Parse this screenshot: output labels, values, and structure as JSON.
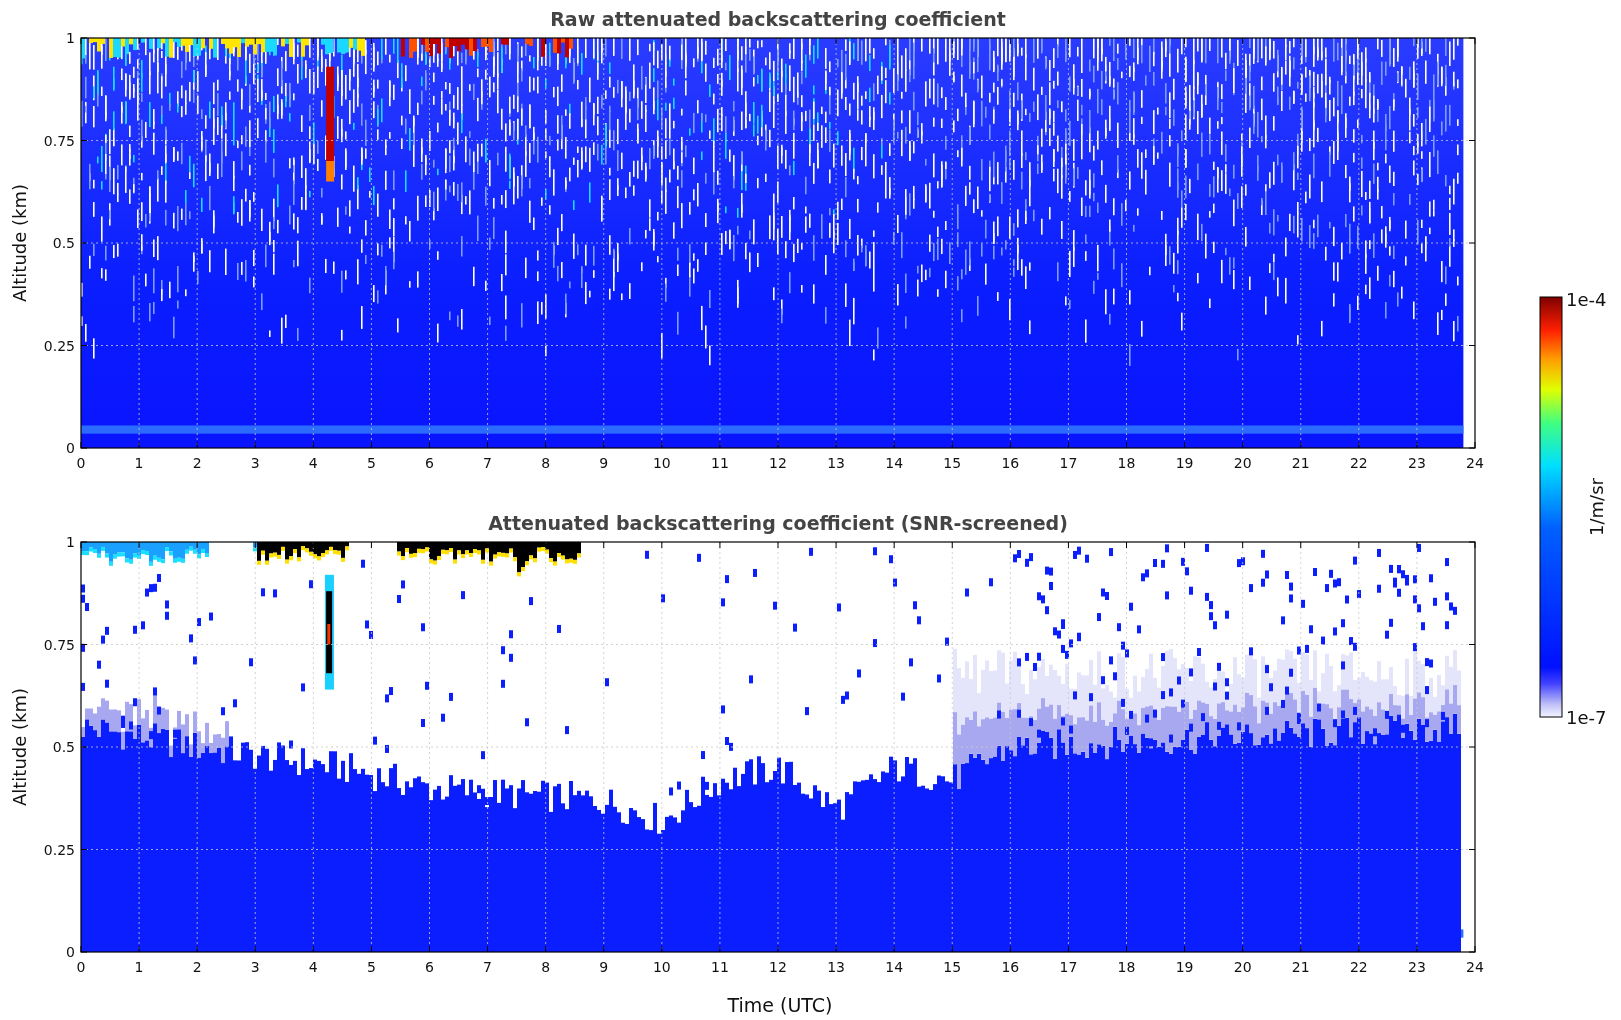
{
  "panels": [
    {
      "kind": "raw",
      "title": "Raw attenuated backscattering coefficient",
      "ylabel": "Altitude (km)",
      "yticks": [
        "1",
        "0.75",
        "0.5",
        "0.25",
        "0"
      ],
      "xticks": [
        "0",
        "1",
        "2",
        "3",
        "4",
        "5",
        "6",
        "7",
        "8",
        "9",
        "10",
        "11",
        "12",
        "13",
        "14",
        "15",
        "16",
        "17",
        "18",
        "19",
        "20",
        "21",
        "22",
        "23",
        "24"
      ]
    },
    {
      "kind": "screened",
      "title": "Attenuated backscattering coefficient (SNR-screened)",
      "ylabel": "Altitude (km)",
      "yticks": [
        "1",
        "0.75",
        "0.5",
        "0.25",
        "0"
      ],
      "xticks": [
        "0",
        "1",
        "2",
        "3",
        "4",
        "5",
        "6",
        "7",
        "8",
        "9",
        "10",
        "11",
        "12",
        "13",
        "14",
        "15",
        "16",
        "17",
        "18",
        "19",
        "20",
        "21",
        "22",
        "23",
        "24"
      ]
    }
  ],
  "xlabel": "Time (UTC)",
  "colorbar": {
    "max_label": "1e-4",
    "min_label": "1e-7",
    "unit": "1/m/sr"
  }
}
